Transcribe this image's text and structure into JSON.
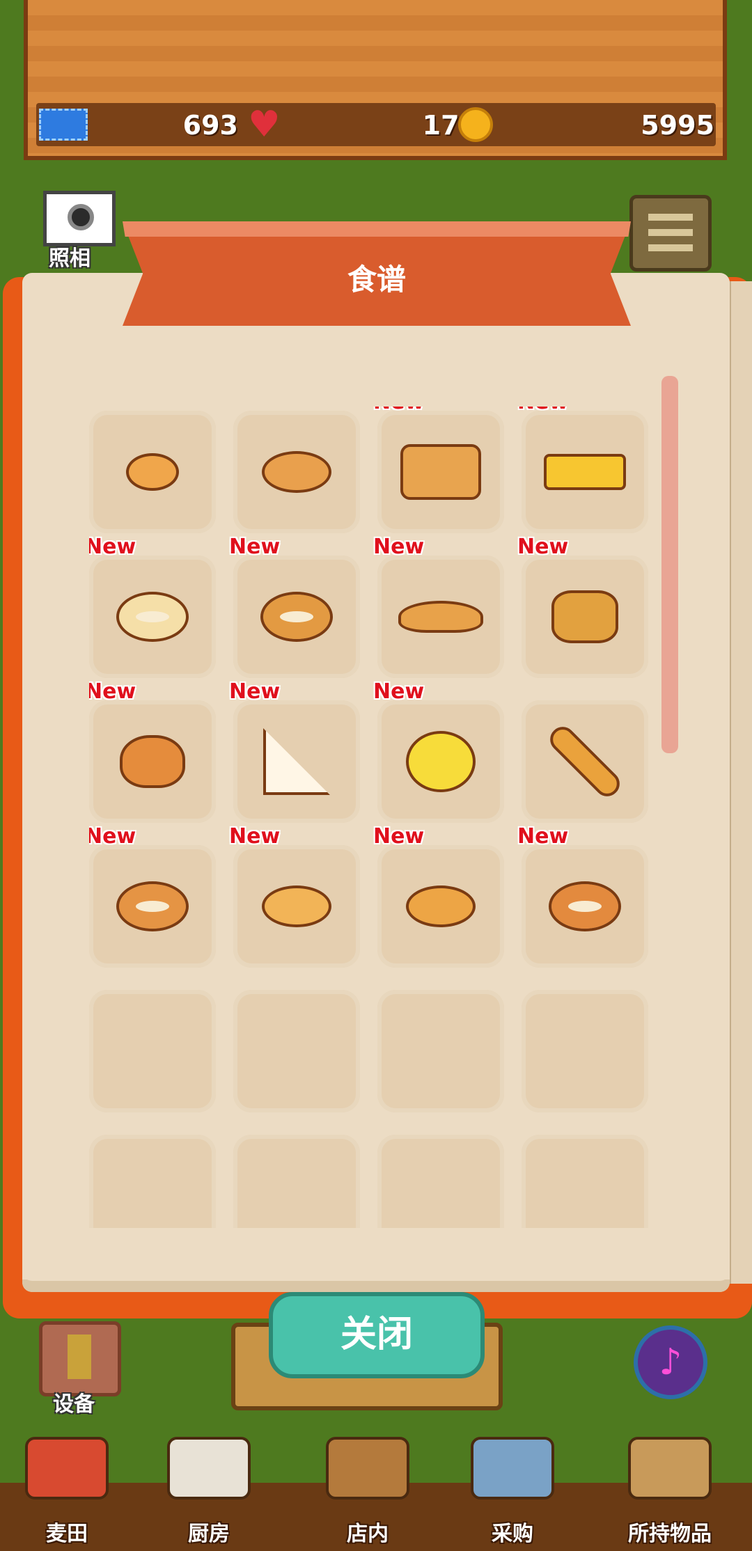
{
  "resources": {
    "tickets": "693",
    "hearts": "176",
    "coins": "5995"
  },
  "camera": {
    "label": "照相",
    "icon": "camera-icon"
  },
  "menu": {
    "icon": "hamburger-menu-icon"
  },
  "recipe_book": {
    "title": "食谱",
    "new_badge": "New",
    "items": [
      {
        "name": "roll",
        "new": false,
        "color": "#f0a64b"
      },
      {
        "name": "bread-loaf-small",
        "new": false,
        "color": "#e9a04d"
      },
      {
        "name": "white-loaf",
        "new": true,
        "color": "#e8a44f"
      },
      {
        "name": "castella",
        "new": true,
        "color": "#f7c630"
      },
      {
        "name": "bagel",
        "new": true,
        "color": "#f5dfa8"
      },
      {
        "name": "donut",
        "new": true,
        "color": "#e39a42"
      },
      {
        "name": "croissant",
        "new": true,
        "color": "#e8a24a"
      },
      {
        "name": "melon-pastry",
        "new": true,
        "color": "#e2a13f"
      },
      {
        "name": "bunny-bread",
        "new": true,
        "color": "#e58c3c"
      },
      {
        "name": "sandwich",
        "new": true,
        "color": "#fff6e6"
      },
      {
        "name": "melon-bread",
        "new": true,
        "color": "#f7dc3a"
      },
      {
        "name": "baguette",
        "new": false,
        "color": "#eaa23c"
      },
      {
        "name": "sprinkle-donut",
        "new": true,
        "color": "#e59444"
      },
      {
        "name": "pizza-bread",
        "new": true,
        "color": "#f2b457"
      },
      {
        "name": "butter-roll",
        "new": true,
        "color": "#eda545"
      },
      {
        "name": "jam-danish",
        "new": true,
        "color": "#e38a3e"
      },
      {
        "name": "",
        "new": false,
        "color": ""
      },
      {
        "name": "",
        "new": false,
        "color": ""
      },
      {
        "name": "",
        "new": false,
        "color": ""
      },
      {
        "name": "",
        "new": false,
        "color": ""
      },
      {
        "name": "",
        "new": false,
        "color": ""
      },
      {
        "name": "",
        "new": false,
        "color": ""
      },
      {
        "name": "",
        "new": false,
        "color": ""
      },
      {
        "name": "",
        "new": false,
        "color": ""
      }
    ]
  },
  "close_button": "关闭",
  "equipment": {
    "label": "设备",
    "icon": "trophy-icon"
  },
  "music": {
    "icon": "music-note-icon"
  },
  "nav": [
    {
      "label": "麦田",
      "icon": "wheat-field-icon"
    },
    {
      "label": "厨房",
      "icon": "kitchen-icon"
    },
    {
      "label": "店内",
      "icon": "bread-basket-icon"
    },
    {
      "label": "采购",
      "icon": "shopping-icon"
    },
    {
      "label": "所持物品",
      "icon": "box-icon"
    }
  ]
}
